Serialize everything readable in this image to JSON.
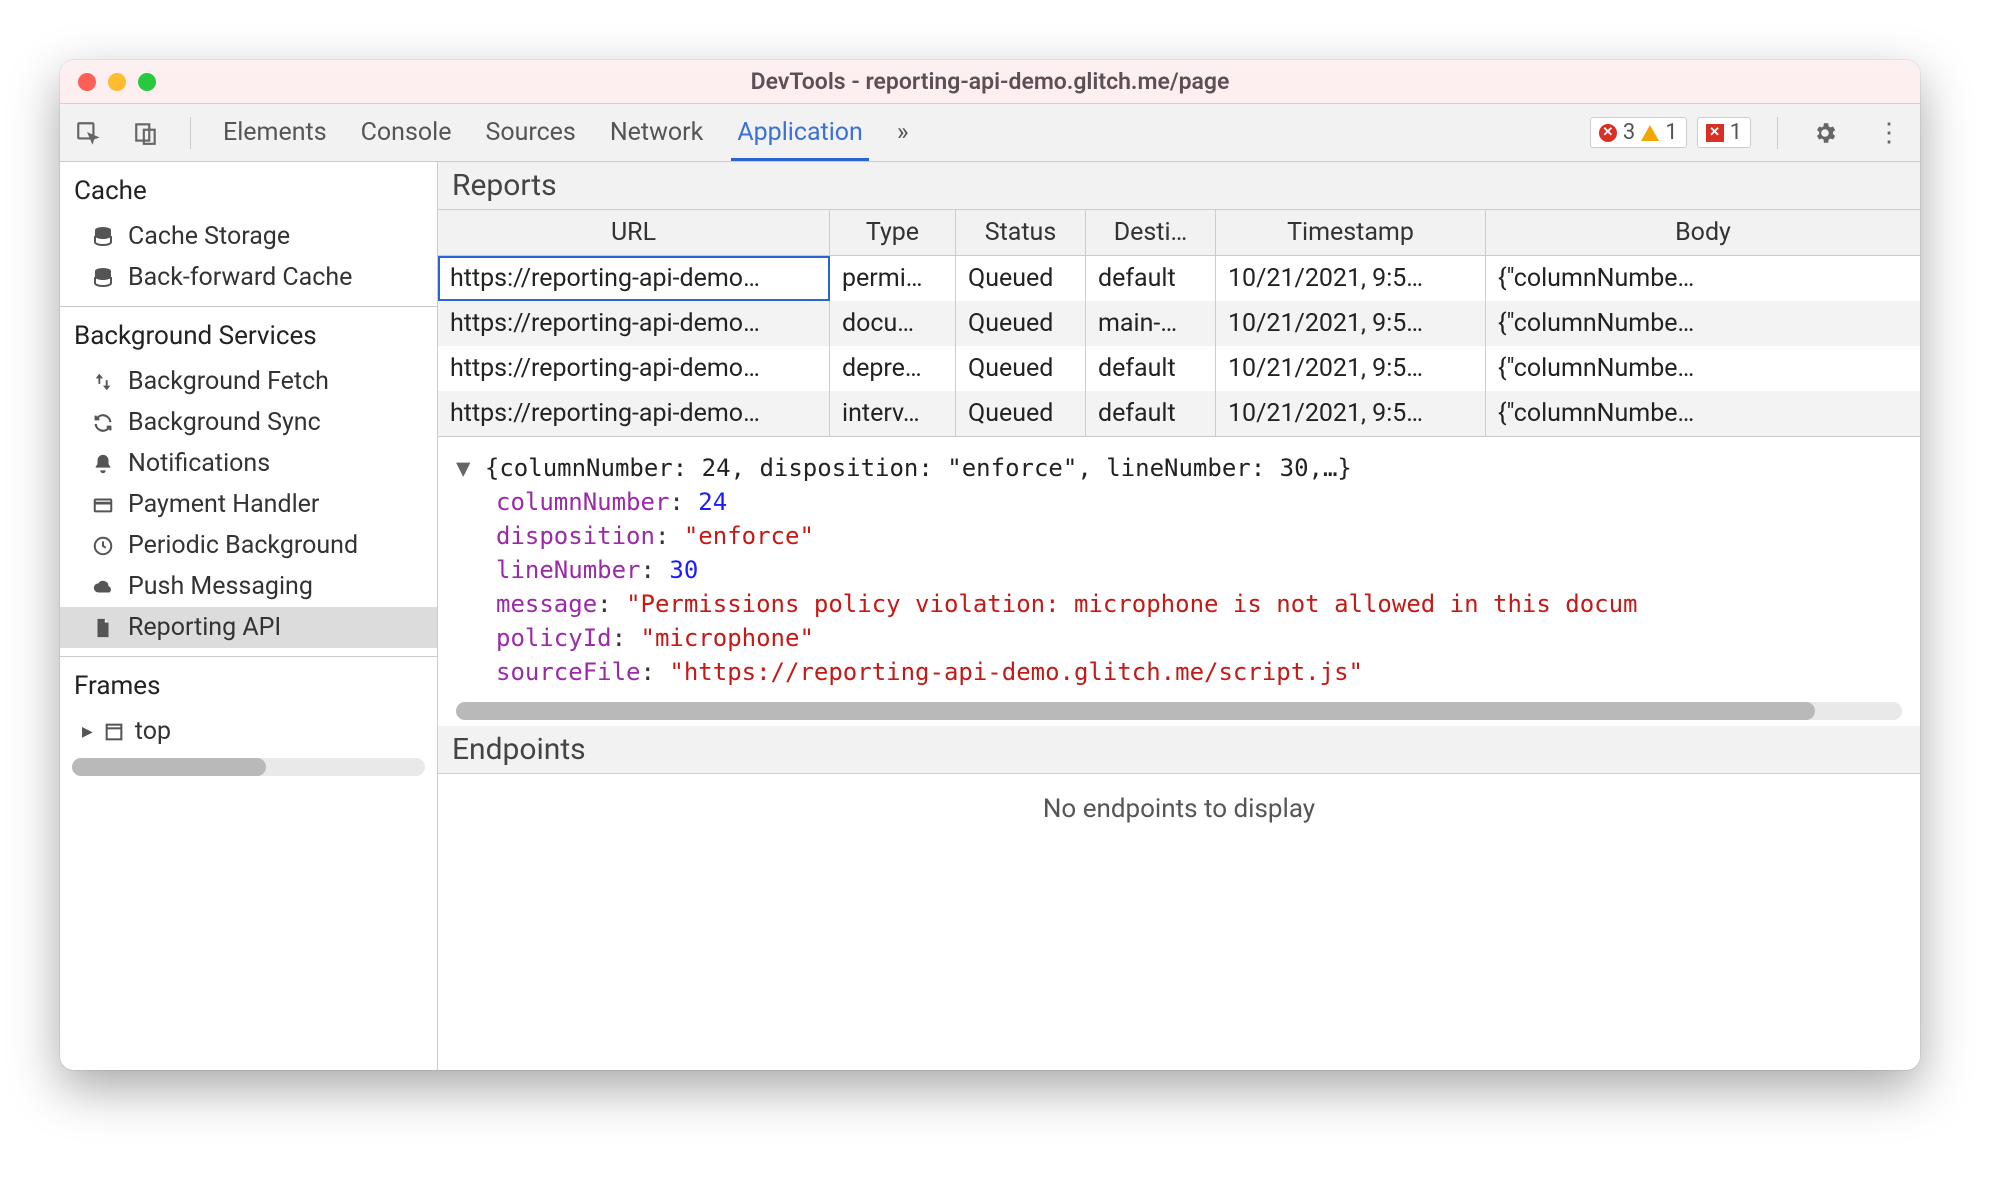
{
  "window": {
    "title": "DevTools - reporting-api-demo.glitch.me/page"
  },
  "tabs": {
    "elements": "Elements",
    "console": "Console",
    "sources": "Sources",
    "network": "Network",
    "application": "Application",
    "more": "»"
  },
  "badges": {
    "errors": "3",
    "warnings": "1",
    "hidden": "1"
  },
  "sidebar": {
    "cache_title": "Cache",
    "cache_items": [
      {
        "label": "Cache Storage",
        "icon": "database"
      },
      {
        "label": "Back-forward Cache",
        "icon": "database"
      }
    ],
    "bg_title": "Background Services",
    "bg_items": [
      {
        "label": "Background Fetch",
        "icon": "updown"
      },
      {
        "label": "Background Sync",
        "icon": "sync"
      },
      {
        "label": "Notifications",
        "icon": "bell"
      },
      {
        "label": "Payment Handler",
        "icon": "card"
      },
      {
        "label": "Periodic Background",
        "icon": "clock"
      },
      {
        "label": "Push Messaging",
        "icon": "cloud"
      },
      {
        "label": "Reporting API",
        "icon": "page",
        "selected": true
      }
    ],
    "frames_title": "Frames",
    "frames_top": "top"
  },
  "reports": {
    "title": "Reports",
    "headers": {
      "url": "URL",
      "type": "Type",
      "status": "Status",
      "dest": "Desti…",
      "ts": "Timestamp",
      "body": "Body"
    },
    "rows": [
      {
        "url": "https://reporting-api-demo…",
        "type": "permi…",
        "status": "Queued",
        "dest": "default",
        "ts": "10/21/2021, 9:5…",
        "body": "{\"columnNumbe…",
        "selected": true
      },
      {
        "url": "https://reporting-api-demo…",
        "type": "docu…",
        "status": "Queued",
        "dest": "main-…",
        "ts": "10/21/2021, 9:5…",
        "body": "{\"columnNumbe…"
      },
      {
        "url": "https://reporting-api-demo…",
        "type": "depre…",
        "status": "Queued",
        "dest": "default",
        "ts": "10/21/2021, 9:5…",
        "body": "{\"columnNumbe…"
      },
      {
        "url": "https://reporting-api-demo…",
        "type": "interv…",
        "status": "Queued",
        "dest": "default",
        "ts": "10/21/2021, 9:5…",
        "body": "{\"columnNumbe…"
      }
    ]
  },
  "detail": {
    "summary": "{columnNumber: 24, disposition: \"enforce\", lineNumber: 30,…}",
    "columnNumber": "24",
    "disposition": "\"enforce\"",
    "lineNumber": "30",
    "message": "\"Permissions policy violation: microphone is not allowed in this docum",
    "policyId": "\"microphone\"",
    "sourceFile": "\"https://reporting-api-demo.glitch.me/script.js\""
  },
  "endpoints": {
    "title": "Endpoints",
    "empty": "No endpoints to display"
  }
}
